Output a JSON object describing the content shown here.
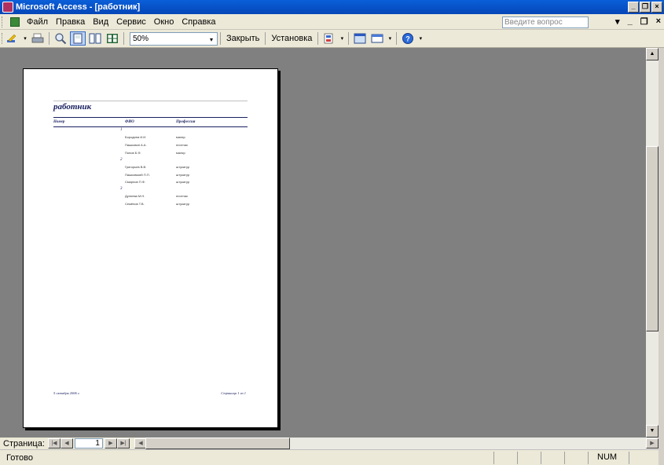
{
  "window": {
    "title": "Microsoft Access - [работник]",
    "min": "_",
    "restore": "❐",
    "close": "×"
  },
  "menu": {
    "items": [
      "Файл",
      "Правка",
      "Вид",
      "Сервис",
      "Окно",
      "Справка"
    ],
    "ask_placeholder": "Введите вопрос",
    "mdi_arrow": "▾",
    "mdi_min": "_",
    "mdi_restore": "❐",
    "mdi_close": "×"
  },
  "toolbar": {
    "zoom_value": "50%",
    "close_label": "Закрыть",
    "setup_label": "Установка"
  },
  "report": {
    "title": "работник",
    "headers": {
      "number": "Номер",
      "fio": "ФИО",
      "profession": "Профессия"
    },
    "groups": [
      {
        "number": "1",
        "rows": [
          {
            "fio": "Бородина И.И.",
            "profession": "маляр"
          },
          {
            "fio": "Пашковин А.А.",
            "profession": "плотник"
          },
          {
            "fio": "Попов Б.Ф.",
            "profession": "маляр"
          }
        ]
      },
      {
        "number": "2",
        "rows": [
          {
            "fio": "Григорьев В.В.",
            "profession": "штукатур"
          },
          {
            "fio": "Пашковский П.П.",
            "profession": "штукатур"
          },
          {
            "fio": "Смирнов П.Ф.",
            "profession": "штукатур"
          }
        ]
      },
      {
        "number": "3",
        "rows": [
          {
            "fio": "Дулнева М.Н.",
            "profession": "плотник"
          },
          {
            "fio": "Семёнов Т.В.",
            "profession": "штукатур"
          }
        ]
      }
    ],
    "footer_date": "5 октября 2006 г.",
    "footer_page": "Страница 1 из 1"
  },
  "navigation": {
    "label": "Страница:",
    "page": "1"
  },
  "status": {
    "text": "Готово",
    "num": "NUM"
  }
}
